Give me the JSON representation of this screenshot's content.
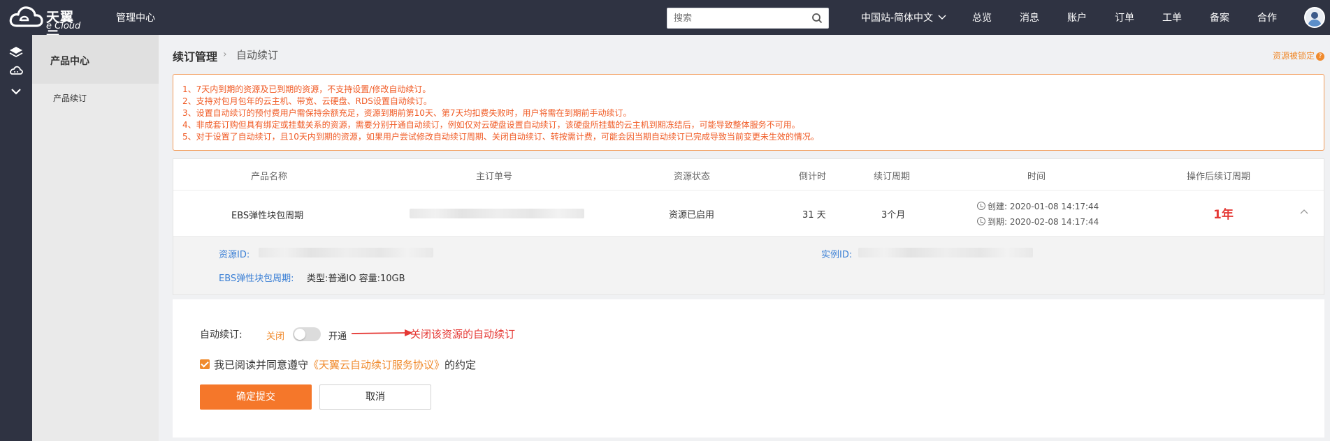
{
  "topbar": {
    "logo_cn": "天翼云",
    "logo_en": "e Cloud",
    "mgmt": "管理中心",
    "search_placeholder": "搜索",
    "site": "中国站-简体中文",
    "nav": [
      "总览",
      "消息",
      "账户",
      "订单",
      "工单",
      "备案",
      "合作"
    ]
  },
  "sidebar": {
    "title": "产品中心",
    "items": [
      "产品续订"
    ]
  },
  "breadcrumb": {
    "parent": "续订管理",
    "current": "自动续订"
  },
  "locked_link": "资源被锁定",
  "notice": [
    "1、7天内到期的资源及已到期的资源，不支持设置/修改自动续订。",
    "2、支持对包月包年的云主机、带宽、云硬盘、RDS设置自动续订。",
    "3、设置自动续订的预付费用户需保持余额充足，资源到期前第10天、第7天均扣费失败时，用户将需在到期前手动续订。",
    "4、非成套订购但具有绑定或挂载关系的资源，需要分别开通自动续订，例如仅对云硬盘设置自动续订，该硬盘所挂载的云主机到期冻结后，可能导致整体服务不可用。",
    "5、对于设置了自动续订，且10天内到期的资源，如果用户尝试修改自动续订周期、关闭自动续订、转按需计费，可能会因当期自动续订已完成导致当前变更未生效的情况。"
  ],
  "table": {
    "headers": [
      "产品名称",
      "主订单号",
      "资源状态",
      "倒计时",
      "续订周期",
      "时间",
      "操作后续订周期"
    ],
    "row": {
      "product": "EBS弹性块包周期",
      "status": "资源已启用",
      "countdown": "31 天",
      "period": "3个月",
      "created": "创建: 2020-01-08 14:17:44",
      "expires": "到期: 2020-02-08 14:17:44",
      "after_period": "1年"
    },
    "detail": {
      "resource_id_label": "资源ID:",
      "instance_id_label": "实例ID:",
      "spec_label": "EBS弹性块包周期:",
      "spec_value": "类型:普通IO 容量:10GB"
    }
  },
  "form": {
    "auto_renew_label": "自动续订:",
    "off": "关闭",
    "on": "开通",
    "annotation": "关闭该资源的自动续订",
    "agree_prefix": "我已阅读并同意遵守",
    "agree_link": "《天翼云自动续订服务协议》",
    "agree_suffix": "的约定",
    "submit": "确定提交",
    "cancel": "取消"
  },
  "colors": {
    "topbar_bg": "#2f3342",
    "accent_orange": "#f5772a",
    "notice_text": "#f05a24",
    "link_blue": "#3a7fd5",
    "highlight_red": "#e53935"
  }
}
